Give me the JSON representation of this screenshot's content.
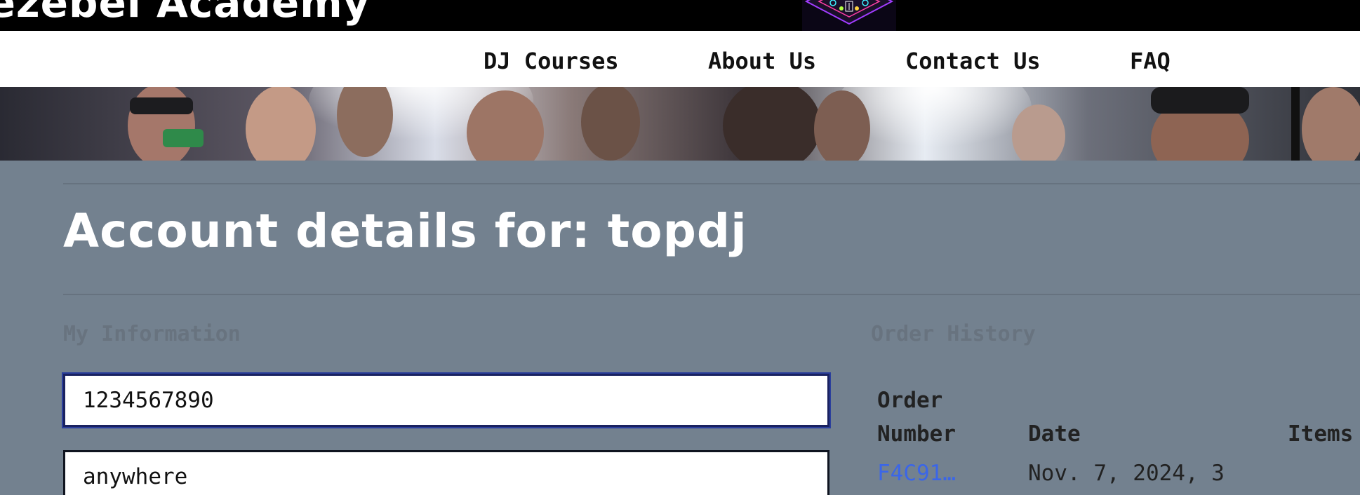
{
  "header": {
    "brand": "Jezebel Academy",
    "logo_icon": "mixer-logo-icon"
  },
  "nav": {
    "items": [
      {
        "label": "DJ Courses"
      },
      {
        "label": "About Us"
      },
      {
        "label": "Contact Us"
      },
      {
        "label": "FAQ"
      }
    ]
  },
  "page": {
    "title": "Account details for: topdj"
  },
  "my_information": {
    "heading": "My Information",
    "phone_value": "1234567890",
    "address_value": "anywhere"
  },
  "order_history": {
    "heading": "Order History",
    "columns": {
      "order_number_line1": "Order",
      "order_number_line2": "Number",
      "date": "Date",
      "items": "Items"
    },
    "rows": [
      {
        "order_number": "F4C91…",
        "date": "Nov. 7, 2024, 3"
      }
    ]
  },
  "colors": {
    "background": "#73818f",
    "link": "#3b66e8",
    "muted_heading": "#68737f"
  }
}
